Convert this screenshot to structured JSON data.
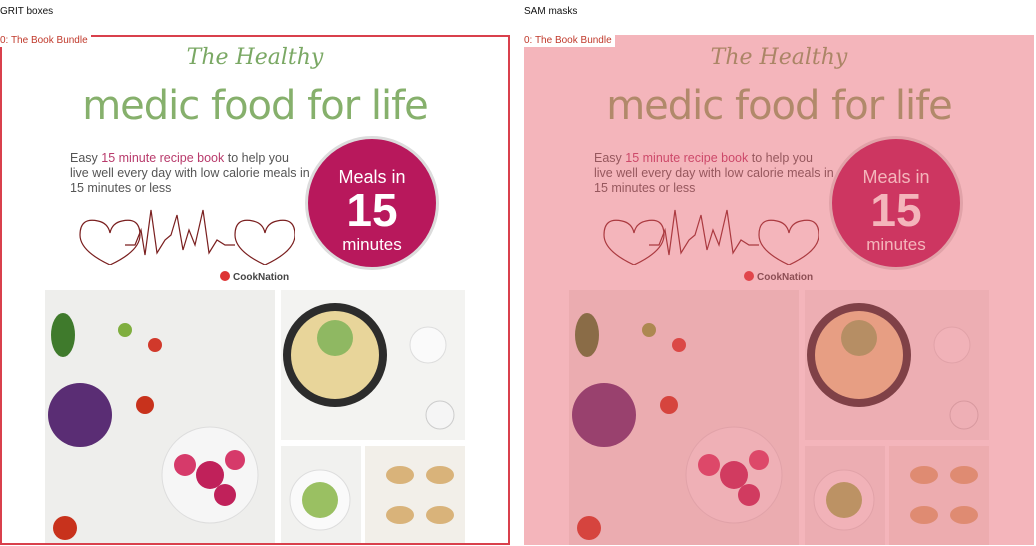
{
  "panels": {
    "left_title": "GRIT boxes",
    "right_title": "SAM masks",
    "left_box_label": "0: The Book Bundle",
    "right_box_label": "0: The Book Bundle"
  },
  "cover": {
    "script_title": "The Healthy",
    "headline": "medic food for life",
    "tagline_a": "Easy ",
    "tagline_accent": "15 minute recipe book",
    "tagline_b": " to help you live well every day with low calorie meals in 15 minutes or less",
    "badge_top": "Meals in",
    "badge_number": "15",
    "badge_bottom": "minutes",
    "brand": "CookNation"
  },
  "colors": {
    "box": "#d9404c",
    "mask": "#e65a69",
    "headline_green": "#86b06c",
    "badge_magenta": "#b8185c"
  }
}
